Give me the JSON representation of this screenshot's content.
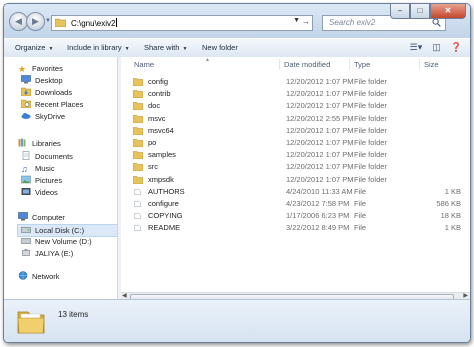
{
  "address": {
    "path": "C:\\gnu\\exiv2"
  },
  "search": {
    "placeholder": "Search exiv2"
  },
  "commands": {
    "organize": "Organize",
    "include_in_library": "Include in library",
    "share_with": "Share with",
    "new_folder": "New folder"
  },
  "nav": {
    "favorites": "Favorites",
    "favorite_items": [
      "Desktop",
      "Downloads",
      "Recent Places",
      "SkyDrive"
    ],
    "libraries": "Libraries",
    "library_items": [
      "Documents",
      "Music",
      "Pictures",
      "Videos"
    ],
    "computer": "Computer",
    "computer_items": [
      "Local Disk (C:)",
      "New Volume (D:)",
      "JALIYA (E:)"
    ],
    "network": "Network"
  },
  "columns": {
    "name": "Name",
    "date_modified": "Date modified",
    "type": "Type",
    "size": "Size"
  },
  "files": [
    {
      "name": "config",
      "date": "12/20/2012 1:07 PM",
      "type": "File folder",
      "size": ""
    },
    {
      "name": "contrib",
      "date": "12/20/2012 1:07 PM",
      "type": "File folder",
      "size": ""
    },
    {
      "name": "doc",
      "date": "12/20/2012 1:07 PM",
      "type": "File folder",
      "size": ""
    },
    {
      "name": "msvc",
      "date": "12/20/2012 2:55 PM",
      "type": "File folder",
      "size": ""
    },
    {
      "name": "msvc64",
      "date": "12/20/2012 1:07 PM",
      "type": "File folder",
      "size": ""
    },
    {
      "name": "po",
      "date": "12/20/2012 1:07 PM",
      "type": "File folder",
      "size": ""
    },
    {
      "name": "samples",
      "date": "12/20/2012 1:07 PM",
      "type": "File folder",
      "size": ""
    },
    {
      "name": "src",
      "date": "12/20/2012 1:07 PM",
      "type": "File folder",
      "size": ""
    },
    {
      "name": "xmpsdk",
      "date": "12/20/2012 1:07 PM",
      "type": "File folder",
      "size": ""
    },
    {
      "name": "AUTHORS",
      "date": "4/24/2010 11:33 AM",
      "type": "File",
      "size": "1 KB"
    },
    {
      "name": "configure",
      "date": "4/23/2012 7:58 PM",
      "type": "File",
      "size": "586 KB"
    },
    {
      "name": "COPYING",
      "date": "1/17/2006 6:23 PM",
      "type": "File",
      "size": "18 KB"
    },
    {
      "name": "README",
      "date": "3/22/2012 8:49 PM",
      "type": "File",
      "size": "1 KB"
    }
  ],
  "status": {
    "item_count": "13 items"
  },
  "colors": {
    "folder": "#e8c25a",
    "selection": "#dbe8f8",
    "chrome": "#c6d7ea"
  }
}
